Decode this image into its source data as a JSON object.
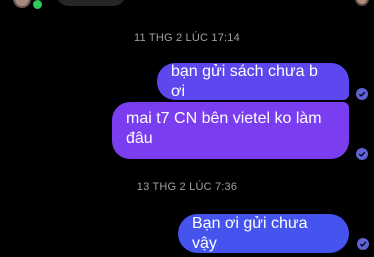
{
  "conversation": {
    "timestamps": [
      "11 THG 2 LÚC 17:14",
      "13 THG 2 LÚC 7:36"
    ],
    "messages": [
      {
        "text": "bạn gửi sách chưa b ơi",
        "direction": "outgoing"
      },
      {
        "text": "mai t7 CN bên vietel ko làm đâu",
        "direction": "outgoing"
      },
      {
        "text": "Bạn ơi gửi chưa vậy",
        "direction": "outgoing"
      }
    ]
  },
  "colors": {
    "background": "#000000",
    "bubble_1": "#5d47ef",
    "bubble_2": "#7a3df0",
    "bubble_3": "#4553ef",
    "timestamp_text": "#a0a0a0",
    "online": "#2fc85a"
  },
  "icons": {
    "seen": "check-circle-icon"
  }
}
